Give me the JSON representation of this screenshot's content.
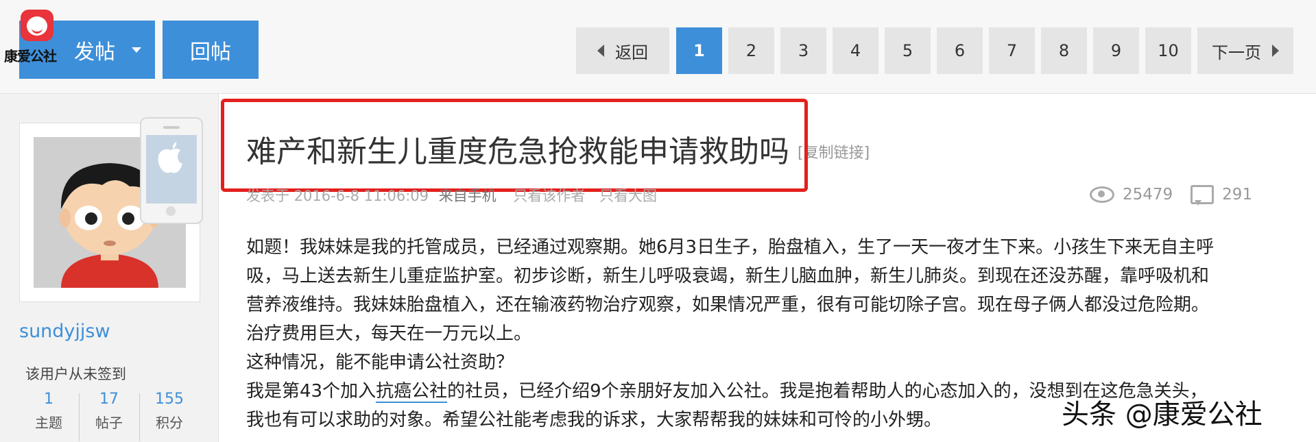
{
  "logo": {
    "text": "康爱公社"
  },
  "toolbar": {
    "post_label": "发帖",
    "reply_label": "回帖"
  },
  "pagination": {
    "back_label": "返回",
    "pages": [
      "1",
      "2",
      "3",
      "4",
      "5",
      "6",
      "7",
      "8",
      "9",
      "10"
    ],
    "current_page": "1",
    "next_label": "下一页"
  },
  "user": {
    "name": "sundyjjsw",
    "signin_text": "该用户从未签到",
    "stats": [
      {
        "value": "1",
        "label": "主题"
      },
      {
        "value": "17",
        "label": "帖子"
      },
      {
        "value": "155",
        "label": "积分"
      }
    ]
  },
  "post": {
    "title": "难产和新生儿重度危急抢救能申请救助吗",
    "copy_link": "[复制链接]",
    "posted_prefix": "发表于",
    "posted_time": "2016-6-8 11:06:09",
    "source": "来自手机",
    "only_author": "只看该作者",
    "only_images": "只看大图",
    "views": "25479",
    "replies": "291",
    "body_lines": [
      "如题！我妹妹是我的托管成员，已经通过观察期。她6月3日生子，胎盘植入，生了一天一夜才生下来。小孩生下来无自主呼",
      "吸，马上送去新生儿重症监护室。初步诊断，新生儿呼吸衰竭，新生儿脑血肿，新生儿肺炎。到现在还没苏醒，靠呼吸机和",
      "营养液维持。我妹妹胎盘植入，还在输液药物治疗观察，如果情况严重，很有可能切除子宫。现在母子俩人都没过危险期。",
      "治疗费用巨大，每天在一万元以上。",
      "这种情况，能不能申请公社资助？"
    ],
    "line6_before": "我是第43个加入",
    "line6_link": "抗癌公社",
    "line6_after": "的社员，已经介绍9个亲朋好友加入公社。我是抱着帮助人的心态加入的，没想到在这危急关头，",
    "line7": "我也有可以求助的对象。希望公社能考虑我的诉求，大家帮帮我的妹妹和可怜的小外甥。"
  },
  "watermark": "头条 @康爱公社",
  "colors": {
    "accent": "#3d8fd9",
    "highlight": "#e3201d"
  }
}
